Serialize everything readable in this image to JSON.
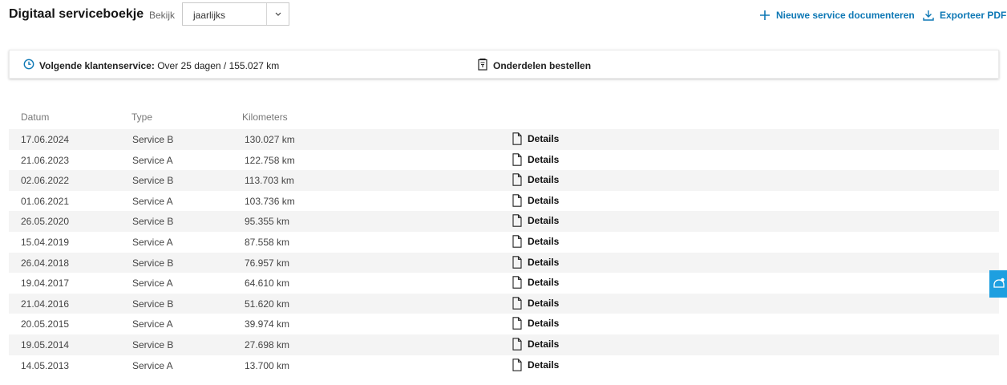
{
  "header": {
    "title": "Digitaal serviceboekje",
    "view_label": "Bekijk",
    "view_select": {
      "selected": "jaarlijks"
    },
    "actions": {
      "new_service": "Nieuwe service documenteren",
      "export_pdf": "Exporteer PDF"
    }
  },
  "info_bar": {
    "next_service_label": "Volgende klantenservice:",
    "next_service_value": "Over 25 dagen / 155.027 km",
    "order_parts": "Onderdelen bestellen"
  },
  "table": {
    "columns": [
      "Datum",
      "Type",
      "Kilometers"
    ],
    "details_label": "Details",
    "rows": [
      {
        "date": "17.06.2024",
        "type": "Service B",
        "km": "130.027 km"
      },
      {
        "date": "21.06.2023",
        "type": "Service A",
        "km": "122.758 km"
      },
      {
        "date": "02.06.2022",
        "type": "Service B",
        "km": "113.703 km"
      },
      {
        "date": "01.06.2021",
        "type": "Service A",
        "km": "103.736 km"
      },
      {
        "date": "26.05.2020",
        "type": "Service B",
        "km": "95.355 km"
      },
      {
        "date": "15.04.2019",
        "type": "Service A",
        "km": "87.558 km"
      },
      {
        "date": "26.04.2018",
        "type": "Service B",
        "km": "76.957 km"
      },
      {
        "date": "19.04.2017",
        "type": "Service A",
        "km": "64.610 km"
      },
      {
        "date": "21.04.2016",
        "type": "Service B",
        "km": "51.620 km"
      },
      {
        "date": "20.05.2015",
        "type": "Service A",
        "km": "39.974 km"
      },
      {
        "date": "19.05.2014",
        "type": "Service B",
        "km": "27.698 km"
      },
      {
        "date": "14.05.2013",
        "type": "Service A",
        "km": "13.700 km"
      }
    ]
  },
  "icons": {
    "plus": "plus-icon",
    "download": "download-icon",
    "clock": "clock-icon",
    "parts": "parts-icon",
    "document": "document-icon",
    "chevron": "chevron-down-icon",
    "chat": "chat-icon"
  },
  "colors": {
    "accent": "#0e78b5",
    "side_tab": "#1e9fe0",
    "row_stripe": "#f4f4f4"
  }
}
